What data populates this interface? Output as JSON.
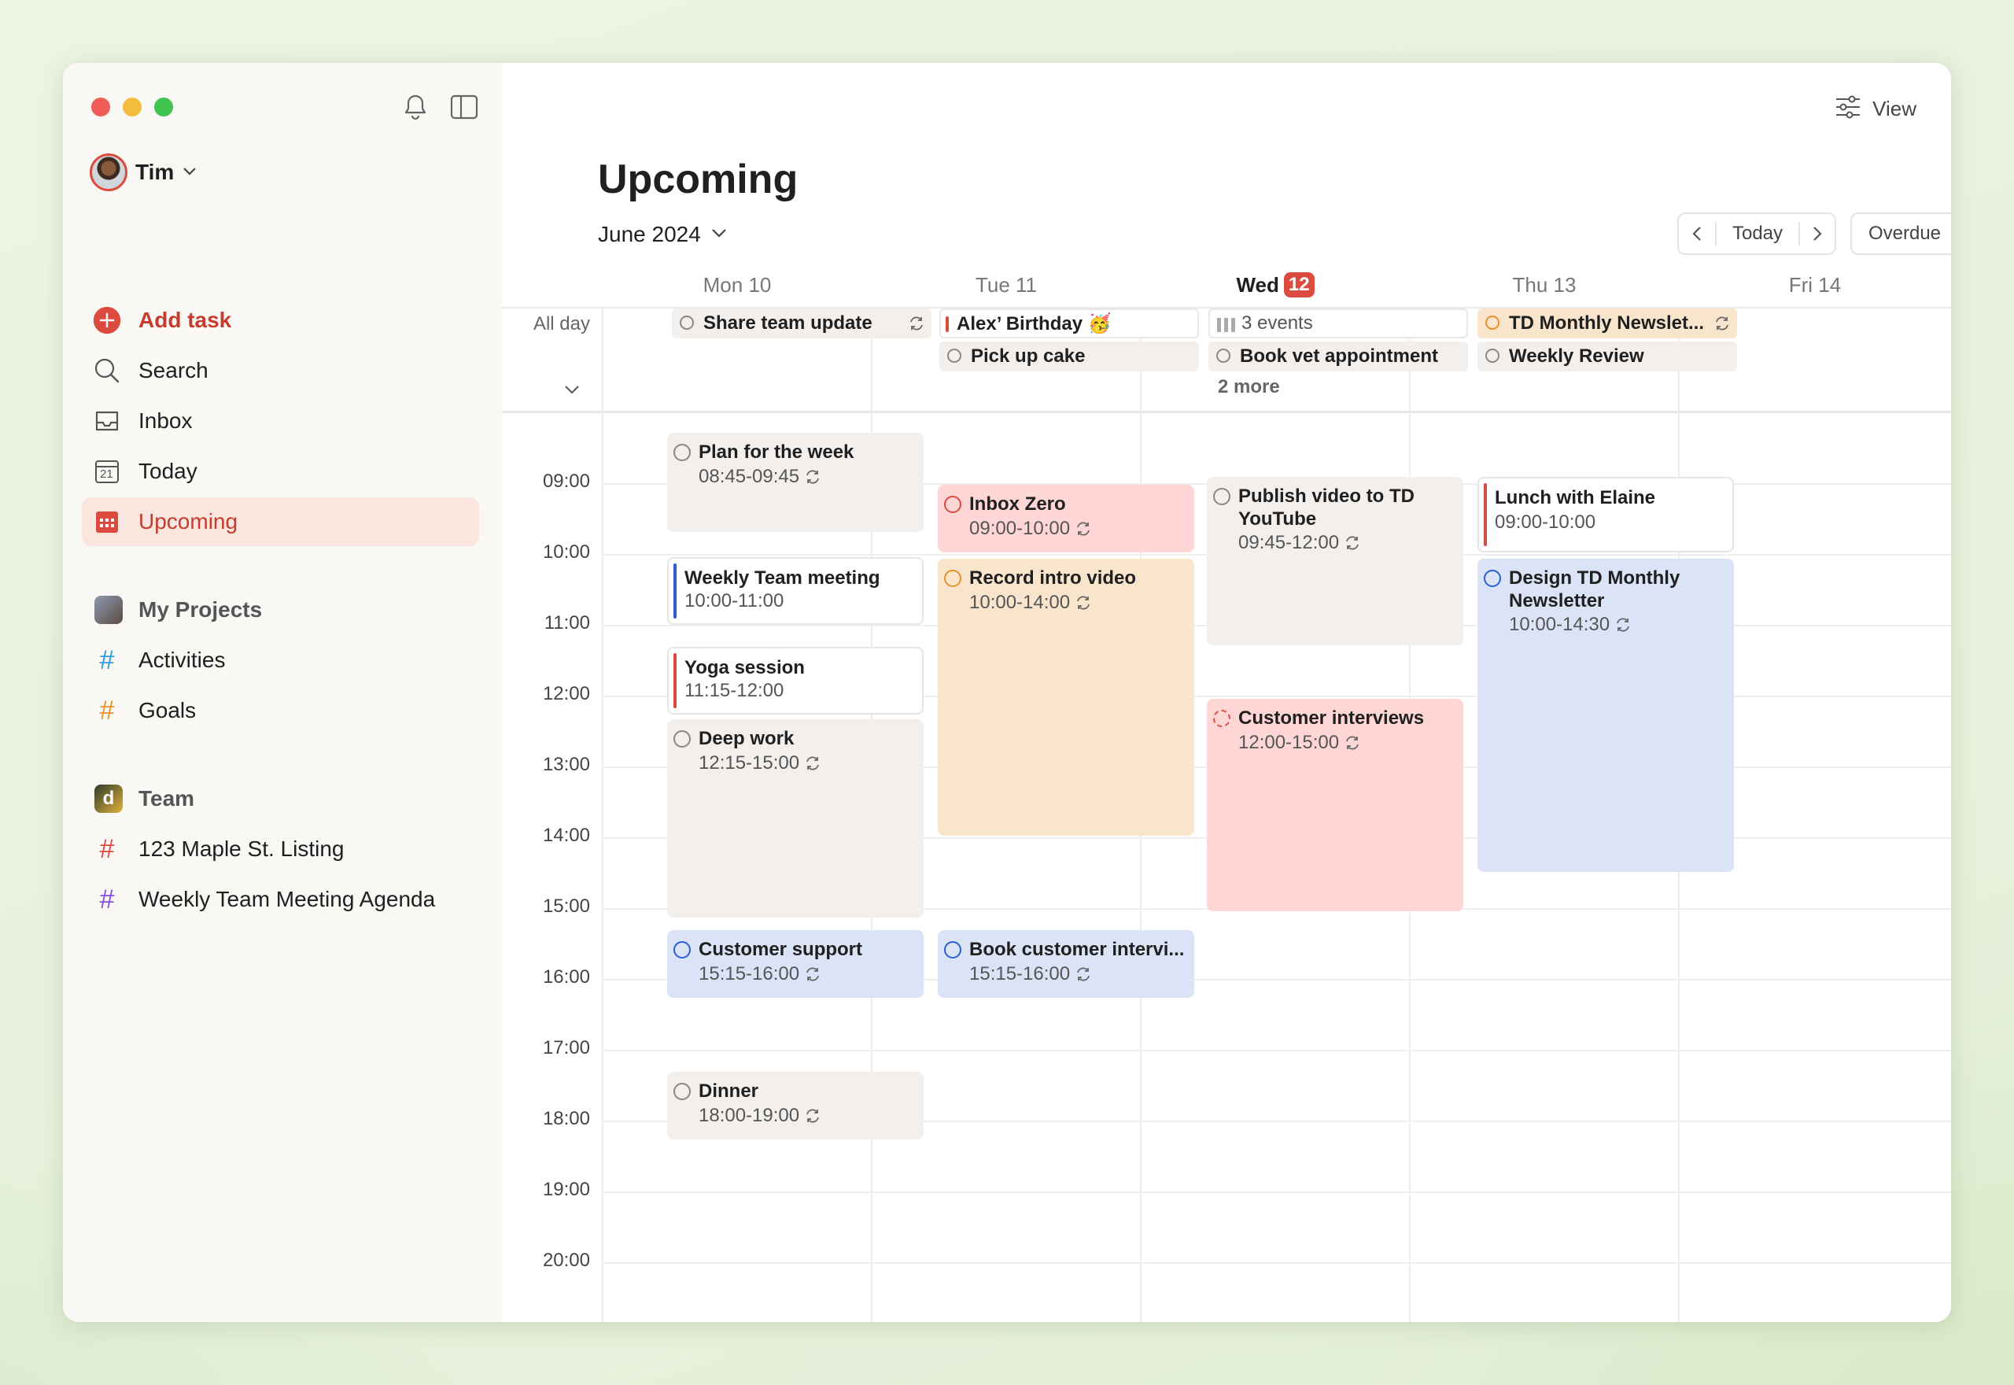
{
  "user": {
    "name": "Tim"
  },
  "sidebar": {
    "add_task": "Add task",
    "search": "Search",
    "inbox": "Inbox",
    "today": "Today",
    "today_icon_day": "21",
    "upcoming": "Upcoming",
    "my_projects": "My Projects",
    "projects": [
      {
        "label": "Activities",
        "color": "#2a9bd0"
      },
      {
        "label": "Goals",
        "color": "#e8912b"
      }
    ],
    "team": "Team",
    "team_projects": [
      {
        "label": "123 Maple St. Listing",
        "color": "#dc4c3e"
      },
      {
        "label": "Weekly Team Meeting Agenda",
        "color": "#8a4fdb"
      }
    ]
  },
  "header": {
    "view_label": "View",
    "title": "Upcoming",
    "month": "June 2024",
    "today_btn": "Today",
    "overdue_btn": "Overdue"
  },
  "days": [
    {
      "label": "Mon 10"
    },
    {
      "label": "Tue 11"
    },
    {
      "label": "Wed",
      "badge": "12",
      "current": true
    },
    {
      "label": "Thu 13"
    },
    {
      "label": "Fri 14"
    }
  ],
  "all_day_label": "All day",
  "all_day": {
    "mon": [
      {
        "title": "Share team update",
        "repeat": true
      }
    ],
    "tue": [
      {
        "title": "Alex’ Birthday 🥳"
      },
      {
        "title": "Pick up cake"
      }
    ],
    "wed": [
      {
        "title": "3 events"
      },
      {
        "title": "Book vet appointment"
      }
    ],
    "wed_more": "2 more",
    "thu": [
      {
        "title": "TD Monthly Newslet...",
        "repeat": true
      },
      {
        "title": "Weekly Review"
      }
    ]
  },
  "times": [
    "09:00",
    "10:00",
    "11:00",
    "12:00",
    "13:00",
    "14:00",
    "15:00",
    "16:00",
    "17:00",
    "18:00",
    "19:00",
    "20:00"
  ],
  "events": {
    "mon": [
      {
        "title": "Plan for the week",
        "time": "08:45-09:45"
      },
      {
        "title": "Weekly Team meeting",
        "time": "10:00-11:00"
      },
      {
        "title": "Yoga session",
        "time": "11:15-12:00"
      },
      {
        "title": "Deep work",
        "time": "12:15-15:00"
      },
      {
        "title": "Customer support",
        "time": "15:15-16:00"
      },
      {
        "title": "Dinner",
        "time": "18:00-19:00"
      }
    ],
    "tue": [
      {
        "title": "Inbox Zero",
        "time": "09:00-10:00"
      },
      {
        "title": "Record intro video",
        "time": "10:00-14:00"
      },
      {
        "title": "Book customer intervi...",
        "time": "15:15-16:00"
      }
    ],
    "wed": [
      {
        "title": "Publish video to TD YouTube",
        "time": "09:45-12:00"
      },
      {
        "title": "Customer interviews",
        "time": "12:00-15:00"
      }
    ],
    "thu": [
      {
        "title": "Lunch with Elaine",
        "time": "09:00-10:00"
      },
      {
        "title": "Design TD Monthly Newsletter",
        "time": "10:00-14:30"
      }
    ]
  },
  "colors": {
    "accent": "#dc4c3e",
    "upcoming_bg": "#fbe6df",
    "gray_event": "#f2efec",
    "red_event": "#ffd6d6",
    "orange_event": "#f9e5cc",
    "blue_event": "#dbe3f6"
  }
}
